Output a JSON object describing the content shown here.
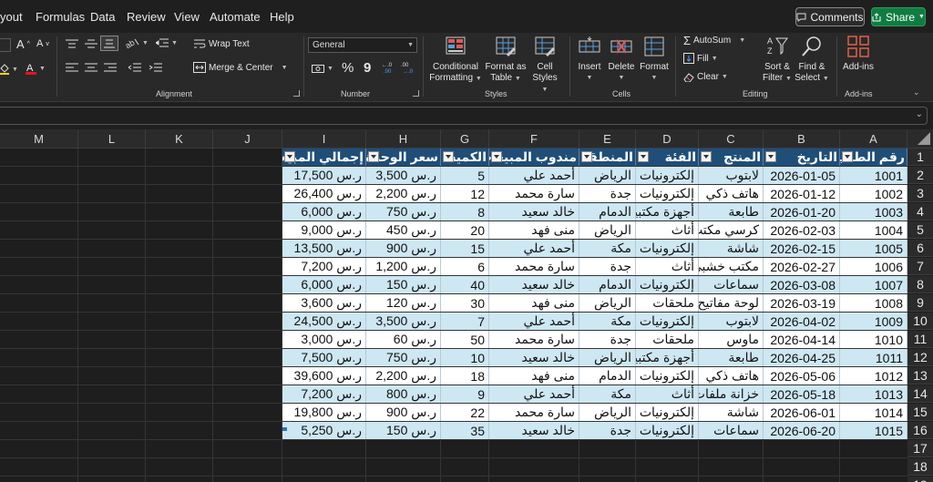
{
  "menu": {
    "items": [
      "yout",
      "Formulas",
      "Data",
      "Review",
      "View",
      "Automate",
      "Help"
    ],
    "comments": "Comments",
    "share": "Share"
  },
  "ribbon": {
    "font": {
      "grow": "A",
      "shrink": "A"
    },
    "alignment": {
      "wrap_text": "Wrap Text",
      "merge_center": "Merge & Center",
      "label": "Alignment"
    },
    "number": {
      "format": "General",
      "percent": "%",
      "comma": "9",
      "label": "Number"
    },
    "styles": {
      "conditional": [
        "Conditional",
        "Formatting"
      ],
      "format_table": [
        "Format as",
        "Table"
      ],
      "cell_styles": [
        "Cell",
        "Styles"
      ],
      "label": "Styles"
    },
    "cells": {
      "insert": "Insert",
      "delete": "Delete",
      "format": "Format",
      "label": "Cells"
    },
    "editing": {
      "autosum": "AutoSum",
      "fill": "Fill",
      "clear": "Clear",
      "sort": [
        "Sort &",
        "Filter"
      ],
      "find": [
        "Find &",
        "Select"
      ],
      "label": "Editing"
    },
    "addins": {
      "btn": "Add-ins",
      "label": "Add-ins"
    }
  },
  "colors": {
    "header": "#1f4e78",
    "band": "#cde7f3",
    "share": "#107c41"
  },
  "columns": [
    "M",
    "L",
    "K",
    "J",
    "I",
    "H",
    "G",
    "F",
    "E",
    "D",
    "C",
    "B",
    "A"
  ],
  "rows": [
    "1",
    "2",
    "3",
    "4",
    "5",
    "6",
    "7",
    "8",
    "9",
    "10",
    "11",
    "12",
    "13",
    "14",
    "15",
    "16",
    "17",
    "18",
    "19"
  ],
  "table": {
    "headers": [
      "إجمالي المبيعة",
      "سعر الوحدة",
      "الكمية",
      "مندوب المبيعات",
      "المنطقة",
      "الفئة",
      "المنتج",
      "التاريخ",
      "رقم الطلب"
    ],
    "rows": [
      [
        "17,500 ر.س",
        "3,500 ر.س",
        "5",
        "أحمد علي",
        "الرياض",
        "إلكترونيات",
        "لابتوب",
        "2026-01-05",
        "1001"
      ],
      [
        "26,400 ر.س",
        "2,200 ر.س",
        "12",
        "سارة محمد",
        "جدة",
        "إلكترونيات",
        "هاتف ذكي",
        "2026-01-12",
        "1002"
      ],
      [
        "6,000 ر.س",
        "750 ر.س",
        "8",
        "خالد سعيد",
        "الدمام",
        "أجهزة مكتبية",
        "طابعة",
        "2026-01-20",
        "1003"
      ],
      [
        "9,000 ر.س",
        "450 ر.س",
        "20",
        "منى فهد",
        "الرياض",
        "أثاث",
        "كرسي مكتب",
        "2026-02-03",
        "1004"
      ],
      [
        "13,500 ر.س",
        "900 ر.س",
        "15",
        "أحمد علي",
        "مكة",
        "إلكترونيات",
        "شاشة",
        "2026-02-15",
        "1005"
      ],
      [
        "7,200 ر.س",
        "1,200 ر.س",
        "6",
        "سارة محمد",
        "جدة",
        "أثاث",
        "مكتب خشبي",
        "2026-02-27",
        "1006"
      ],
      [
        "6,000 ر.س",
        "150 ر.س",
        "40",
        "خالد سعيد",
        "الدمام",
        "إلكترونيات",
        "سماعات",
        "2026-03-08",
        "1007"
      ],
      [
        "3,600 ر.س",
        "120 ر.س",
        "30",
        "منى فهد",
        "الرياض",
        "ملحقات",
        "لوحة مفاتيح",
        "2026-03-19",
        "1008"
      ],
      [
        "24,500 ر.س",
        "3,500 ر.س",
        "7",
        "أحمد علي",
        "مكة",
        "إلكترونيات",
        "لابتوب",
        "2026-04-02",
        "1009"
      ],
      [
        "3,000 ر.س",
        "60 ر.س",
        "50",
        "سارة محمد",
        "جدة",
        "ملحقات",
        "ماوس",
        "2026-04-14",
        "1010"
      ],
      [
        "7,500 ر.س",
        "750 ر.س",
        "10",
        "خالد سعيد",
        "الرياض",
        "أجهزة مكتبية",
        "طابعة",
        "2026-04-25",
        "1011"
      ],
      [
        "39,600 ر.س",
        "2,200 ر.س",
        "18",
        "منى فهد",
        "الدمام",
        "إلكترونيات",
        "هاتف ذكي",
        "2026-05-06",
        "1012"
      ],
      [
        "7,200 ر.س",
        "800 ر.س",
        "9",
        "أحمد علي",
        "مكة",
        "أثاث",
        "خزانة ملفات",
        "2026-05-18",
        "1013"
      ],
      [
        "19,800 ر.س",
        "900 ر.س",
        "22",
        "سارة محمد",
        "الرياض",
        "إلكترونيات",
        "شاشة",
        "2026-06-01",
        "1014"
      ],
      [
        "5,250 ر.س",
        "150 ر.س",
        "35",
        "خالد سعيد",
        "جدة",
        "إلكترونيات",
        "سماعات",
        "2026-06-20",
        "1015"
      ]
    ]
  }
}
